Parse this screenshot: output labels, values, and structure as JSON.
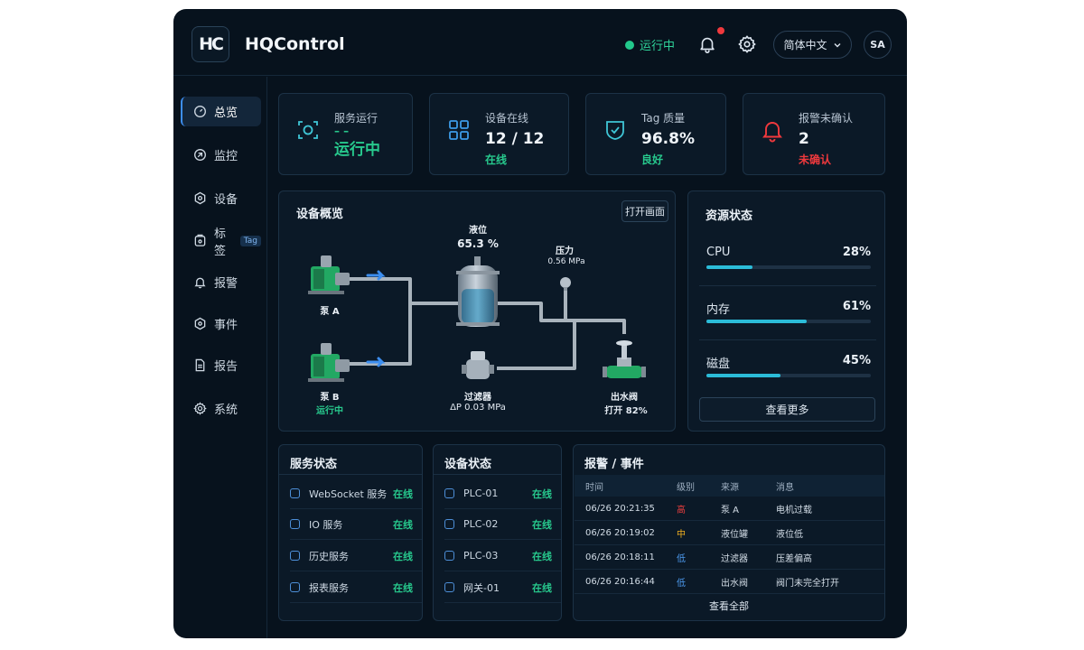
{
  "header": {
    "logo_text": "HC",
    "brand": "HQControl",
    "run_status": "运行中",
    "language": "简体中文",
    "avatar": "SA"
  },
  "nav": [
    {
      "label": "总览",
      "icon": "dashboard-icon",
      "active": true
    },
    {
      "label": "监控",
      "icon": "monitor-icon"
    },
    {
      "label": "设备",
      "icon": "device-icon"
    },
    {
      "label": "标签",
      "icon": "tag-icon",
      "chip": "Tag"
    },
    {
      "label": "报警",
      "icon": "bell-icon"
    },
    {
      "label": "事件",
      "icon": "event-icon"
    },
    {
      "label": "报告",
      "icon": "report-icon"
    },
    {
      "label": "系统",
      "icon": "settings-icon"
    }
  ],
  "stats": [
    {
      "label": "服务运行",
      "value": "运行中",
      "dash": "– –",
      "icon": "service-icon",
      "color": "#27c98d"
    },
    {
      "label": "设备在线",
      "value": "12 / 12",
      "sub": "在线",
      "icon": "grid-icon",
      "color": "#27c98d"
    },
    {
      "label": "Tag 质量",
      "value": "96.8%",
      "sub": "良好",
      "icon": "shield-icon",
      "color": "#27c98d"
    },
    {
      "label": "报警未确认",
      "value": "2",
      "sub": "未确认",
      "icon": "alarm-icon",
      "color": "#f0393d"
    }
  ],
  "overview": {
    "title": "设备概览",
    "open_button": "打开画面",
    "tank": {
      "label": "液位",
      "value": "65.3 %",
      "level": 0.653
    },
    "pressure": {
      "label": "压力",
      "value": "0.56 MPa"
    },
    "pump_a": {
      "label": "泵 A"
    },
    "pump_b": {
      "label": "泵 B",
      "status": "运行中"
    },
    "filter": {
      "label": "过滤器",
      "value": "ΔP 0.03 MPa"
    },
    "valve": {
      "label": "出水阀",
      "value": "打开 82%"
    }
  },
  "resources": {
    "title": "资源状态",
    "items": [
      {
        "label": "CPU",
        "value": "28%",
        "pct": 28
      },
      {
        "label": "内存",
        "value": "61%",
        "pct": 61
      },
      {
        "label": "磁盘",
        "value": "45%",
        "pct": 45
      }
    ],
    "more_button": "查看更多"
  },
  "services": {
    "title": "服务状态",
    "items": [
      {
        "name": "WebSocket 服务",
        "status": "在线"
      },
      {
        "name": "IO 服务",
        "status": "在线"
      },
      {
        "name": "历史服务",
        "status": "在线"
      },
      {
        "name": "报表服务",
        "status": "在线"
      }
    ]
  },
  "devices": {
    "title": "设备状态",
    "items": [
      {
        "name": "PLC-01",
        "status": "在线"
      },
      {
        "name": "PLC-02",
        "status": "在线"
      },
      {
        "name": "PLC-03",
        "status": "在线"
      },
      {
        "name": "网关-01",
        "status": "在线"
      }
    ]
  },
  "alarms": {
    "title": "报警 / 事件",
    "headers": [
      "时间",
      "级别",
      "来源",
      "消息"
    ],
    "rows": [
      {
        "time": "06/26 20:21:35",
        "level": "高",
        "level_class": "lvl-high",
        "source": "泵 A",
        "message": "电机过载"
      },
      {
        "time": "06/26 20:19:02",
        "level": "中",
        "level_class": "lvl-mid",
        "source": "液位罐",
        "message": "液位低"
      },
      {
        "time": "06/26 20:18:11",
        "level": "低",
        "level_class": "lvl-low",
        "source": "过滤器",
        "message": "压差偏高"
      },
      {
        "time": "06/26 20:16:44",
        "level": "低",
        "level_class": "lvl-low",
        "source": "出水阀",
        "message": "阀门未完全打开"
      }
    ],
    "view_all": "查看全部"
  }
}
